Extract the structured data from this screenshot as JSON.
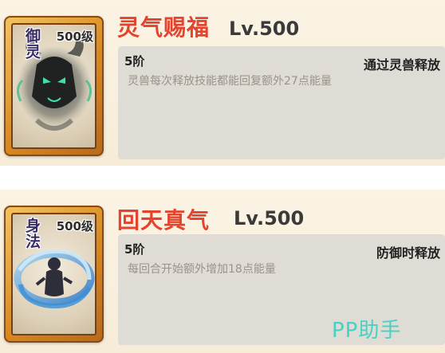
{
  "skills": [
    {
      "card_type": "御灵",
      "card_level": "500级",
      "name": "灵气赐福",
      "level": "Lv.500",
      "tier": "5阶",
      "trigger": "通过灵兽释放",
      "description": "灵兽每次释放技能都能回复额外27点能量",
      "art": "dark-beast-spirit"
    },
    {
      "card_type": "身法",
      "card_level": "500级",
      "name": "回天真气",
      "level": "Lv.500",
      "tier": "5阶",
      "trigger": "防御时释放",
      "description": "每回合开始额外增加18点能量",
      "art": "whirlwind-figure"
    }
  ],
  "watermark": "PP助手",
  "colors": {
    "title_red": "#e4432d",
    "card_gold": "#d98a1f",
    "info_box": "#dedcd5",
    "watermark": "#49d0c4"
  }
}
